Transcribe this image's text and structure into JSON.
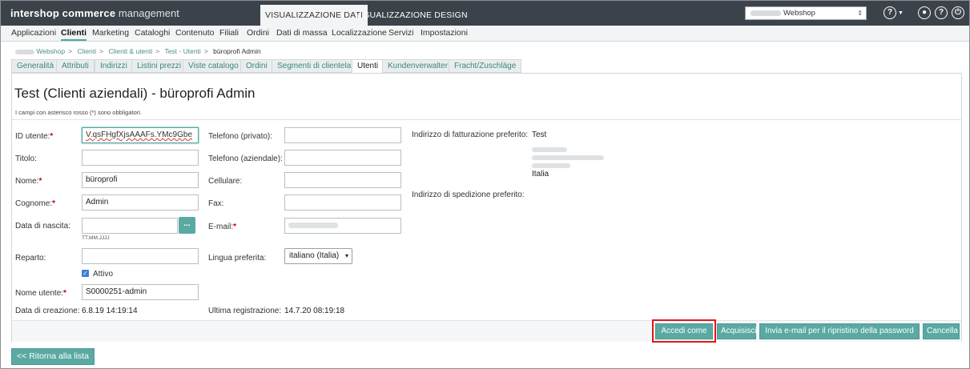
{
  "topbar": {
    "logo_brand": "intershop",
    "logo_bold": "commerce",
    "logo_rest": "management",
    "mode_tabs": [
      "VISUALIZZAZIONE DATI",
      "VISUALIZZAZIONE DESIGN"
    ],
    "shop_select": "Webshop",
    "icons": [
      "help-dropdown-icon",
      "user-icon",
      "help-icon",
      "power-icon"
    ]
  },
  "mainnav": [
    "Applicazioni",
    "Clienti",
    "Marketing",
    "Cataloghi",
    "Contenuto",
    "Filiali",
    "Ordini",
    "Dati di massa",
    "Localizzazione",
    "Servizi",
    "Impostazioni"
  ],
  "breadcrumb": [
    "Webshop",
    "Clienti",
    "Clienti & utenti",
    "Test - Utenti",
    "büroprofi Admin"
  ],
  "subtabs": [
    "Generalità",
    "Attributi",
    "Indirizzi",
    "Listini prezzi",
    "Viste catalogo",
    "Ordini",
    "Segmenti di clientela",
    "Utenti",
    "Kundenverwalter",
    "Fracht/Zuschläge"
  ],
  "page": {
    "title": "Test (Clienti aziendali) - büroprofi Admin",
    "req_note_pre": "I campi con asterisco rosso (",
    "req_note_star": "*",
    "req_note_post": ") sono obbligatori."
  },
  "form": {
    "user_id_label": "ID utente:",
    "user_id_value": "V.qsFHgfXjsAAAFs.YMc9Gbe",
    "title_label": "Titolo:",
    "firstname_label": "Nome:",
    "firstname_value": "büroprofi",
    "lastname_label": "Cognome:",
    "lastname_value": "Admin",
    "birthdate_label": "Data di nascita:",
    "birthdate_button": "...",
    "birthdate_hint": "TT.MM.JJJJ",
    "department_label": "Reparto:",
    "active_label": "Attivo",
    "username_label": "Nome utente:",
    "username_value": "S0000251-admin",
    "created_label": "Data di creazione:",
    "created_value": "6.8.19 14:19:14",
    "phone_private_label": "Telefono (privato):",
    "phone_business_label": "Telefono (aziendale):",
    "mobile_label": "Cellulare:",
    "fax_label": "Fax:",
    "email_label": "E-mail:",
    "language_label": "Lingua preferita:",
    "language_value": "italiano (Italia)",
    "last_login_label": "Ultima registrazione:",
    "last_login_value": "14.7.20 08:19:18",
    "billing_label": "Indirizzo di fatturazione preferito:",
    "billing_name": "Test",
    "billing_country": "Italia",
    "shipping_label": "Indirizzo di spedizione preferito:",
    "star": "*"
  },
  "buttons": {
    "login_as": "Accedi come",
    "acquire": "Acquisisci",
    "send_reset": "Invia e-mail per il ripristino della password",
    "delete": "Cancella",
    "back": "<< Ritorna alla lista"
  }
}
